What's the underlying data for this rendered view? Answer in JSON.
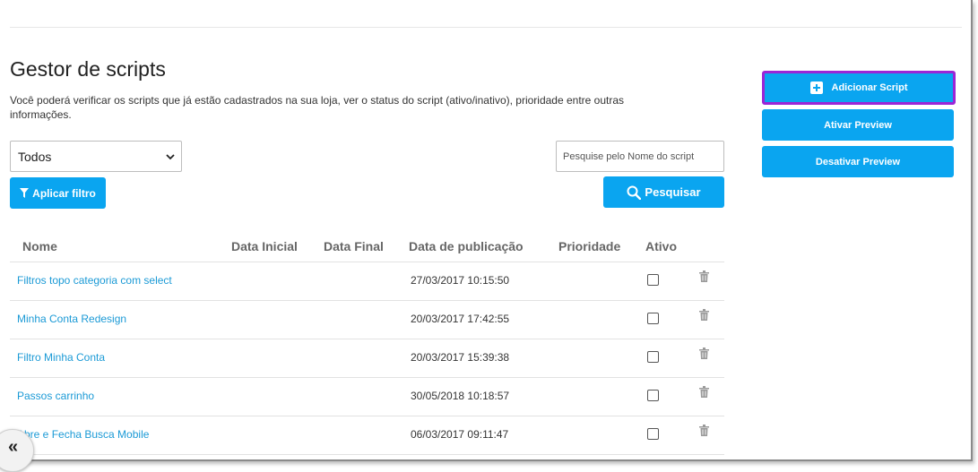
{
  "header": {
    "title": "Gestor de scripts",
    "description": "Você poderá verificar os scripts que já estão cadastrados na sua loja, ver o status do script (ativo/inativo), prioridade entre outras informações."
  },
  "filters": {
    "status_selected": "Todos",
    "apply_label": "Aplicar filtro",
    "search_placeholder": "Pesquise pelo Nome do script",
    "search_label": "Pesquisar"
  },
  "actions": {
    "add_label": "Adicionar Script",
    "preview_on_label": "Ativar Preview",
    "preview_off_label": "Desativar Preview"
  },
  "table": {
    "columns": [
      "Nome",
      "Data Inicial",
      "Data Final",
      "Data de publicação",
      "Prioridade",
      "Ativo"
    ],
    "rows": [
      {
        "name": "Filtros topo categoria com select",
        "published": "27/03/2017 10:15:50",
        "active": false
      },
      {
        "name": "Minha Conta Redesign",
        "published": "20/03/2017 17:42:55",
        "active": false
      },
      {
        "name": "Filtro Minha Conta",
        "published": "20/03/2017 15:39:38",
        "active": false
      },
      {
        "name": "Passos carrinho",
        "published": "30/05/2018 10:18:57",
        "active": false
      },
      {
        "name": "Abre e Fecha Busca Mobile",
        "published": "06/03/2017 09:11:47",
        "active": false
      }
    ]
  },
  "colors": {
    "primary": "#0aa5f0",
    "highlight_border": "#9b25d6",
    "link": "#1b9ad6"
  },
  "icons": {
    "filter": "funnel-icon",
    "search": "magnifier-icon",
    "add": "plus-square-icon",
    "delete": "trash-icon",
    "collapse": "double-chevron-left-icon",
    "select": "chevron-down-icon"
  }
}
